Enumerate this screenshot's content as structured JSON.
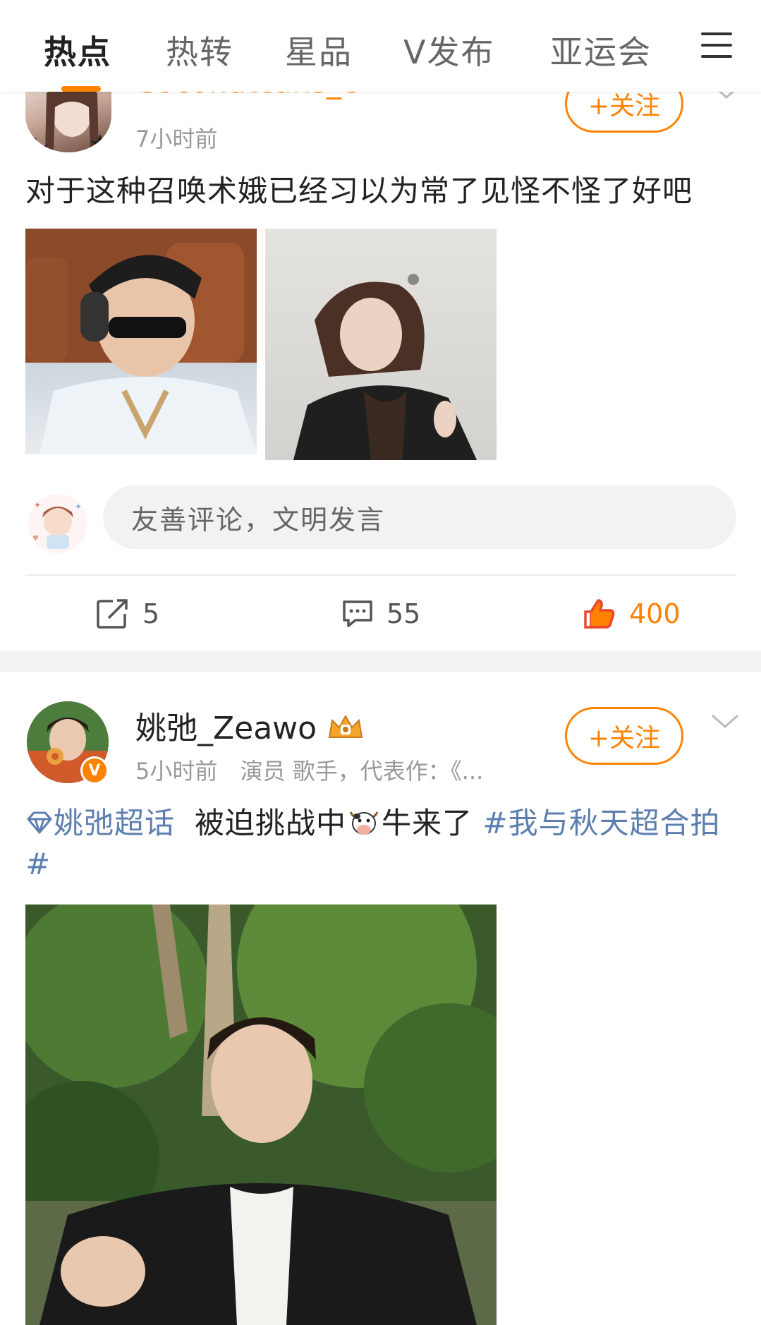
{
  "nav": {
    "tabs": [
      "热点",
      "热转",
      "星品",
      "V发布",
      "亚运会"
    ],
    "active_tab": "热点",
    "accent": "#ff8200"
  },
  "post1": {
    "username_partial": "Coconutcake_e",
    "time": "7小时前",
    "follow_label": "+关注",
    "text": "对于这种召唤术娥已经习以为常了见怪不怪了好吧",
    "comment_placeholder": "友善评论，文明发言",
    "repost_count": "5",
    "comment_count": "55",
    "like_count": "400"
  },
  "post2": {
    "username": "姚弛_Zeawo",
    "time": "5小时前",
    "bio": "演员 歌手，代表作：《...",
    "follow_label": "+关注",
    "supertopic": "姚弛超话",
    "text_main": "被迫挑战中",
    "text_after_emoji": "牛来了",
    "hashtag": "#我与秋天超合拍#"
  }
}
